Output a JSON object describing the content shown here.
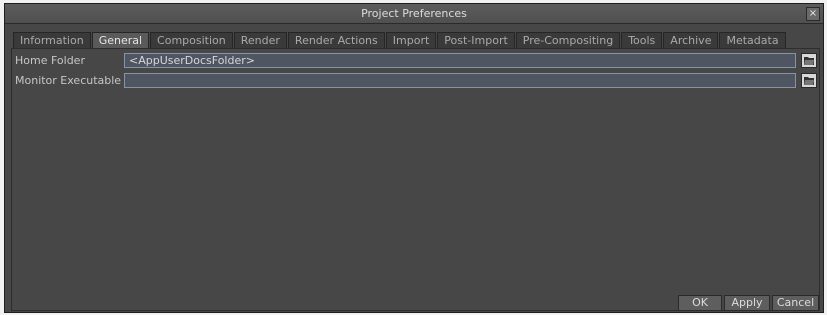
{
  "window": {
    "title": "Project Preferences",
    "close_glyph": "×"
  },
  "tabs": [
    {
      "label": "Information"
    },
    {
      "label": "General",
      "active": true
    },
    {
      "label": "Composition"
    },
    {
      "label": "Render"
    },
    {
      "label": "Render Actions"
    },
    {
      "label": "Import"
    },
    {
      "label": "Post-Import"
    },
    {
      "label": "Pre-Compositing"
    },
    {
      "label": "Tools"
    },
    {
      "label": "Archive"
    },
    {
      "label": "Metadata"
    }
  ],
  "general": {
    "home_folder": {
      "label": "Home Folder",
      "value": "<AppUserDocsFolder>",
      "browse_icon": "folder-browse-icon"
    },
    "monitor_executable": {
      "label": "Monitor Executable",
      "value": "",
      "browse_icon": "folder-browse-icon"
    }
  },
  "buttons": {
    "ok": "OK",
    "apply": "Apply",
    "cancel": "Cancel"
  }
}
